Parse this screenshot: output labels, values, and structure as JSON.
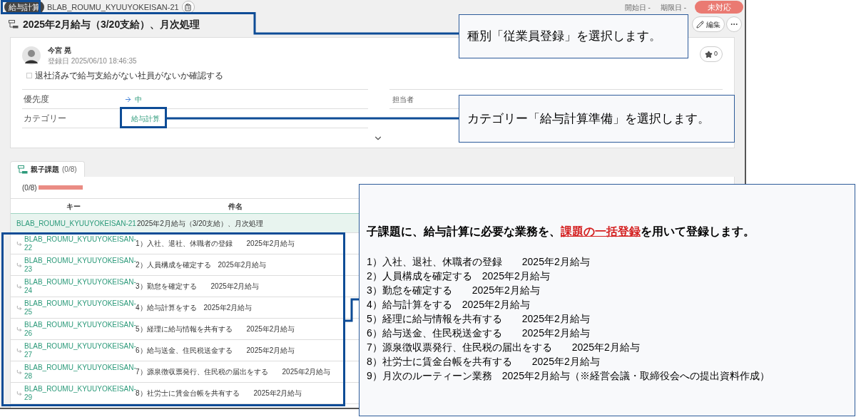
{
  "header": {
    "category_tag": "給与計算",
    "issue_key": "BLAB_ROUMU_KYUUYOKEISAN-21",
    "start_date": "開始日 -",
    "due_date": "期限日 -",
    "status": "未対応"
  },
  "title": "2025年2月給与（3/20支給）、月次処理",
  "edit_button": "編集",
  "card": {
    "author": "今宮 晃",
    "registered": "登録日 2025/06/10 18:46:35",
    "star_count": "0",
    "checklist": [
      {
        "label": "退社済みで給与支給がない社員がないか確認する",
        "checked": false
      }
    ],
    "fields": [
      {
        "label": "優先度",
        "value": "中",
        "kind": "priority"
      },
      {
        "label": "カテゴリー",
        "value": "給与計算",
        "kind": "link"
      }
    ],
    "side_fields": [
      {
        "label": "担当者"
      }
    ]
  },
  "tab": {
    "label": "親子課題",
    "count": "(0/8)",
    "selected": true
  },
  "progress": {
    "label": "(0/8)",
    "level": 0
  },
  "table": {
    "columns": [
      "キー",
      "件名"
    ],
    "parent": {
      "key": "BLAB_ROUMU_KYUUYOKEISAN-21",
      "subject": "2025年2月給与（3/20支給）、月次処理"
    },
    "rows": [
      {
        "key": "BLAB_ROUMU_KYUUYOKEISAN-22",
        "subject": "1）入社、退社、休職者の登録　　2025年2月給与"
      },
      {
        "key": "BLAB_ROUMU_KYUUYOKEISAN-23",
        "subject": "2）人員構成を確定する　2025年2月給与"
      },
      {
        "key": "BLAB_ROUMU_KYUUYOKEISAN-24",
        "subject": "3）勤怠を確定する　　2025年2月給与"
      },
      {
        "key": "BLAB_ROUMU_KYUUYOKEISAN-25",
        "subject": "4）給与計算をする　2025年2月給与"
      },
      {
        "key": "BLAB_ROUMU_KYUUYOKEISAN-26",
        "subject": "5）経理に給与情報を共有する　　2025年2月給与"
      },
      {
        "key": "BLAB_ROUMU_KYUUYOKEISAN-27",
        "subject": "6）給与送金、住民税送金する　　2025年2月給与"
      },
      {
        "key": "BLAB_ROUMU_KYUUYOKEISAN-28",
        "subject": "7）源泉徴収票発行、住民税の届出をする　　2025年2月給与"
      },
      {
        "key": "BLAB_ROUMU_KYUUYOKEISAN-29",
        "subject": "8）社労士に賃金台帳を共有する　　2025年2月給与"
      }
    ]
  },
  "callouts": [
    "種別「従業員登録」を選択します。",
    "カテゴリー「給与計算準備」を選択します。"
  ],
  "note": {
    "before": "子課題に、給与計算に必要な業務を、",
    "link": "課題の一括登録",
    "after": "を用いて登録します。",
    "lines": [
      "1）入社、退社、休職者の登録　　2025年2月給与",
      "2）人員構成を確定する　2025年2月給与",
      "3）勤怠を確定する　　2025年2月給与",
      "4）給与計算をする　2025年2月給与",
      "5）経理に給与情報を共有する　　2025年2月給与",
      "6）給与送金、住民税送金する　　2025年2月給与",
      "7）源泉徴収票発行、住民税の届出をする　　2025年2月給与",
      "8）社労士に賃金台帳を共有する　　2025年2月給与",
      "9）月次のルーティーン業務　2025年2月給与（※経営会議・取締役会への提出資料作成）"
    ]
  }
}
